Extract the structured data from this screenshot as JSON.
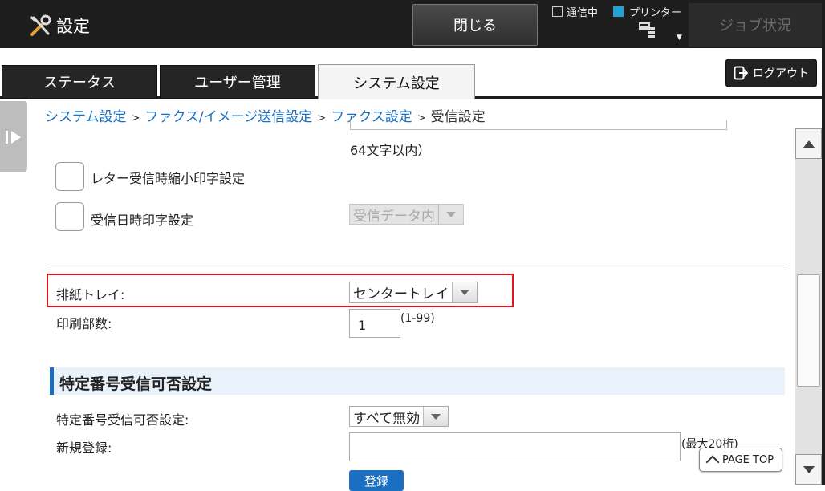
{
  "header": {
    "title": "設定",
    "close_label": "閉じる",
    "comm_label": "通信中",
    "printer_label": "プリンター",
    "job_status_label": "ジョブ状況",
    "icons": {
      "title": "tools-icon",
      "printer": "printer-queue-icon"
    },
    "colors": {
      "printer_indicator": "#1fa3d6"
    }
  },
  "tabs": [
    {
      "label": "ステータス"
    },
    {
      "label": "ユーザー管理"
    },
    {
      "label": "システム設定"
    }
  ],
  "logout_label": "ログアウト",
  "breadcrumb": {
    "items": [
      "システム設定",
      "ファクス/イメージ送信設定",
      "ファクス設定"
    ],
    "current": "受信設定",
    "separator": ">"
  },
  "form": {
    "char_limit_note": "64文字以内）",
    "letter_shrink_label": "レター受信時縮小印字設定",
    "recv_datetime_label": "受信日時印字設定",
    "recv_datetime_select": "受信データ内",
    "output_tray_label": "排紙トレイ:",
    "output_tray_select": "センタートレイ",
    "copies_label": "印刷部数:",
    "copies_value": "1",
    "copies_range": "(1-99)",
    "section_title": "特定番号受信可否設定",
    "specific_label": "特定番号受信可否設定:",
    "specific_select": "すべて無効",
    "new_reg_label": "新規登録:",
    "new_reg_max": "(最大20桁)",
    "register_label": "登録"
  },
  "page_top_label": "PAGE TOP",
  "highlight_color": "#e0141e"
}
